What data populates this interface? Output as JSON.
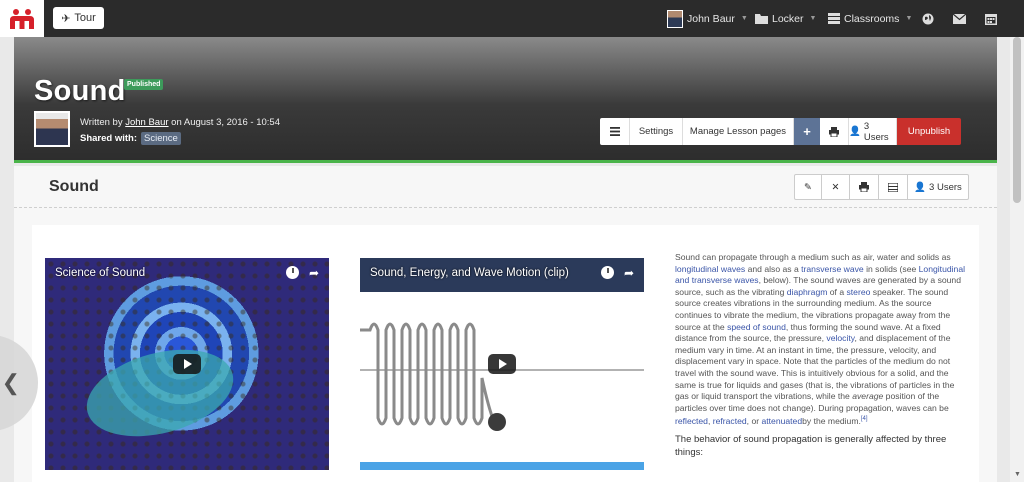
{
  "nav": {
    "tour_label": "Tour",
    "user_name": "John Baur",
    "locker_label": "Locker",
    "classrooms_label": "Classrooms"
  },
  "header": {
    "title": "Sound",
    "status_badge": "Published",
    "written_by_prefix": "Written by ",
    "author": "John Baur",
    "date_text": " on August 3, 2016 - 10:54",
    "shared_label": "Shared with:",
    "shared_tag": "Science",
    "actions": {
      "settings": "Settings",
      "manage_pages": "Manage Lesson pages",
      "users": "3 Users",
      "unpublish": "Unpublish"
    }
  },
  "section": {
    "title": "Sound",
    "users": "3 Users"
  },
  "videos": [
    {
      "title": "Science of Sound"
    },
    {
      "title": "Sound, Energy, and Wave Motion (clip)"
    }
  ],
  "article": {
    "t1": "Sound can propagate through a medium such as air, water and solids as ",
    "l1": "longitudinal waves",
    "t2": " and also as a ",
    "l2": "transverse wave",
    "t3": " in solids (see ",
    "l3": "Longitudinal and transverse waves",
    "t4": ", below). The sound waves are generated by a sound source, such as the vibrating ",
    "l4": "diaphragm",
    "t5": " of a ",
    "l5": "stereo",
    "t6": " speaker. The sound source creates vibrations in the surrounding medium. As the source continues to vibrate the medium, the vibrations propagate away from the source at the ",
    "l6": "speed of sound",
    "t7": ", thus forming the sound wave. At a fixed distance from the source, the pressure, ",
    "l7": "velocity",
    "t8": ", and displacement of the medium vary in time. At an instant in time, the pressure, velocity, and displacement vary in space. Note that the particles of the medium do not travel with the sound wave. This is intuitively obvious for a solid, and the same is true for liquids and gases (that is, the vibrations of particles in the gas or liquid transport the vibrations, while the ",
    "em1": "average",
    "t9": " position of the particles over time does not change). During propagation, waves can be ",
    "l8": "reflected",
    "t10": ", ",
    "l9": "refracted",
    "t11": ", or ",
    "l10": "attenuated",
    "t12": "by the medium.",
    "cite": "[4]",
    "heading": "The behavior of sound propagation is generally affected by three things:"
  }
}
